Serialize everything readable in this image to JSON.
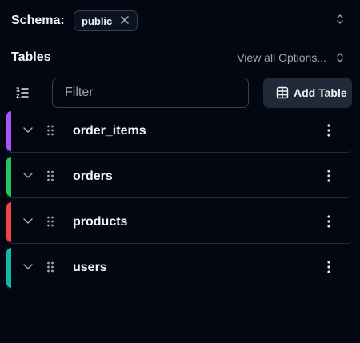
{
  "schema": {
    "label": "Schema:",
    "selected": "public",
    "icons": {
      "remove": "close-icon",
      "switch": "chevron-up-down-icon"
    }
  },
  "tables_header": {
    "title": "Tables",
    "view_all": "View all Options..."
  },
  "toolbar": {
    "filter_placeholder": "Filter",
    "filter_value": "",
    "add_table_label": "Add Table",
    "icons": {
      "list": "list-ordered-icon",
      "add": "table-icon"
    }
  },
  "tables": [
    {
      "name": "order_items",
      "color": "#a855f7"
    },
    {
      "name": "orders",
      "color": "#22c55e"
    },
    {
      "name": "products",
      "color": "#ef4444"
    },
    {
      "name": "users",
      "color": "#14b8a6"
    }
  ],
  "row_icons": {
    "expand": "chevron-down-icon",
    "drag": "drag-handle-icon",
    "menu": "more-vertical-icon"
  },
  "colors": {
    "background": "#030712",
    "border": "#1f2937",
    "text": "#f3f4f6",
    "muted": "#9ca3af"
  }
}
